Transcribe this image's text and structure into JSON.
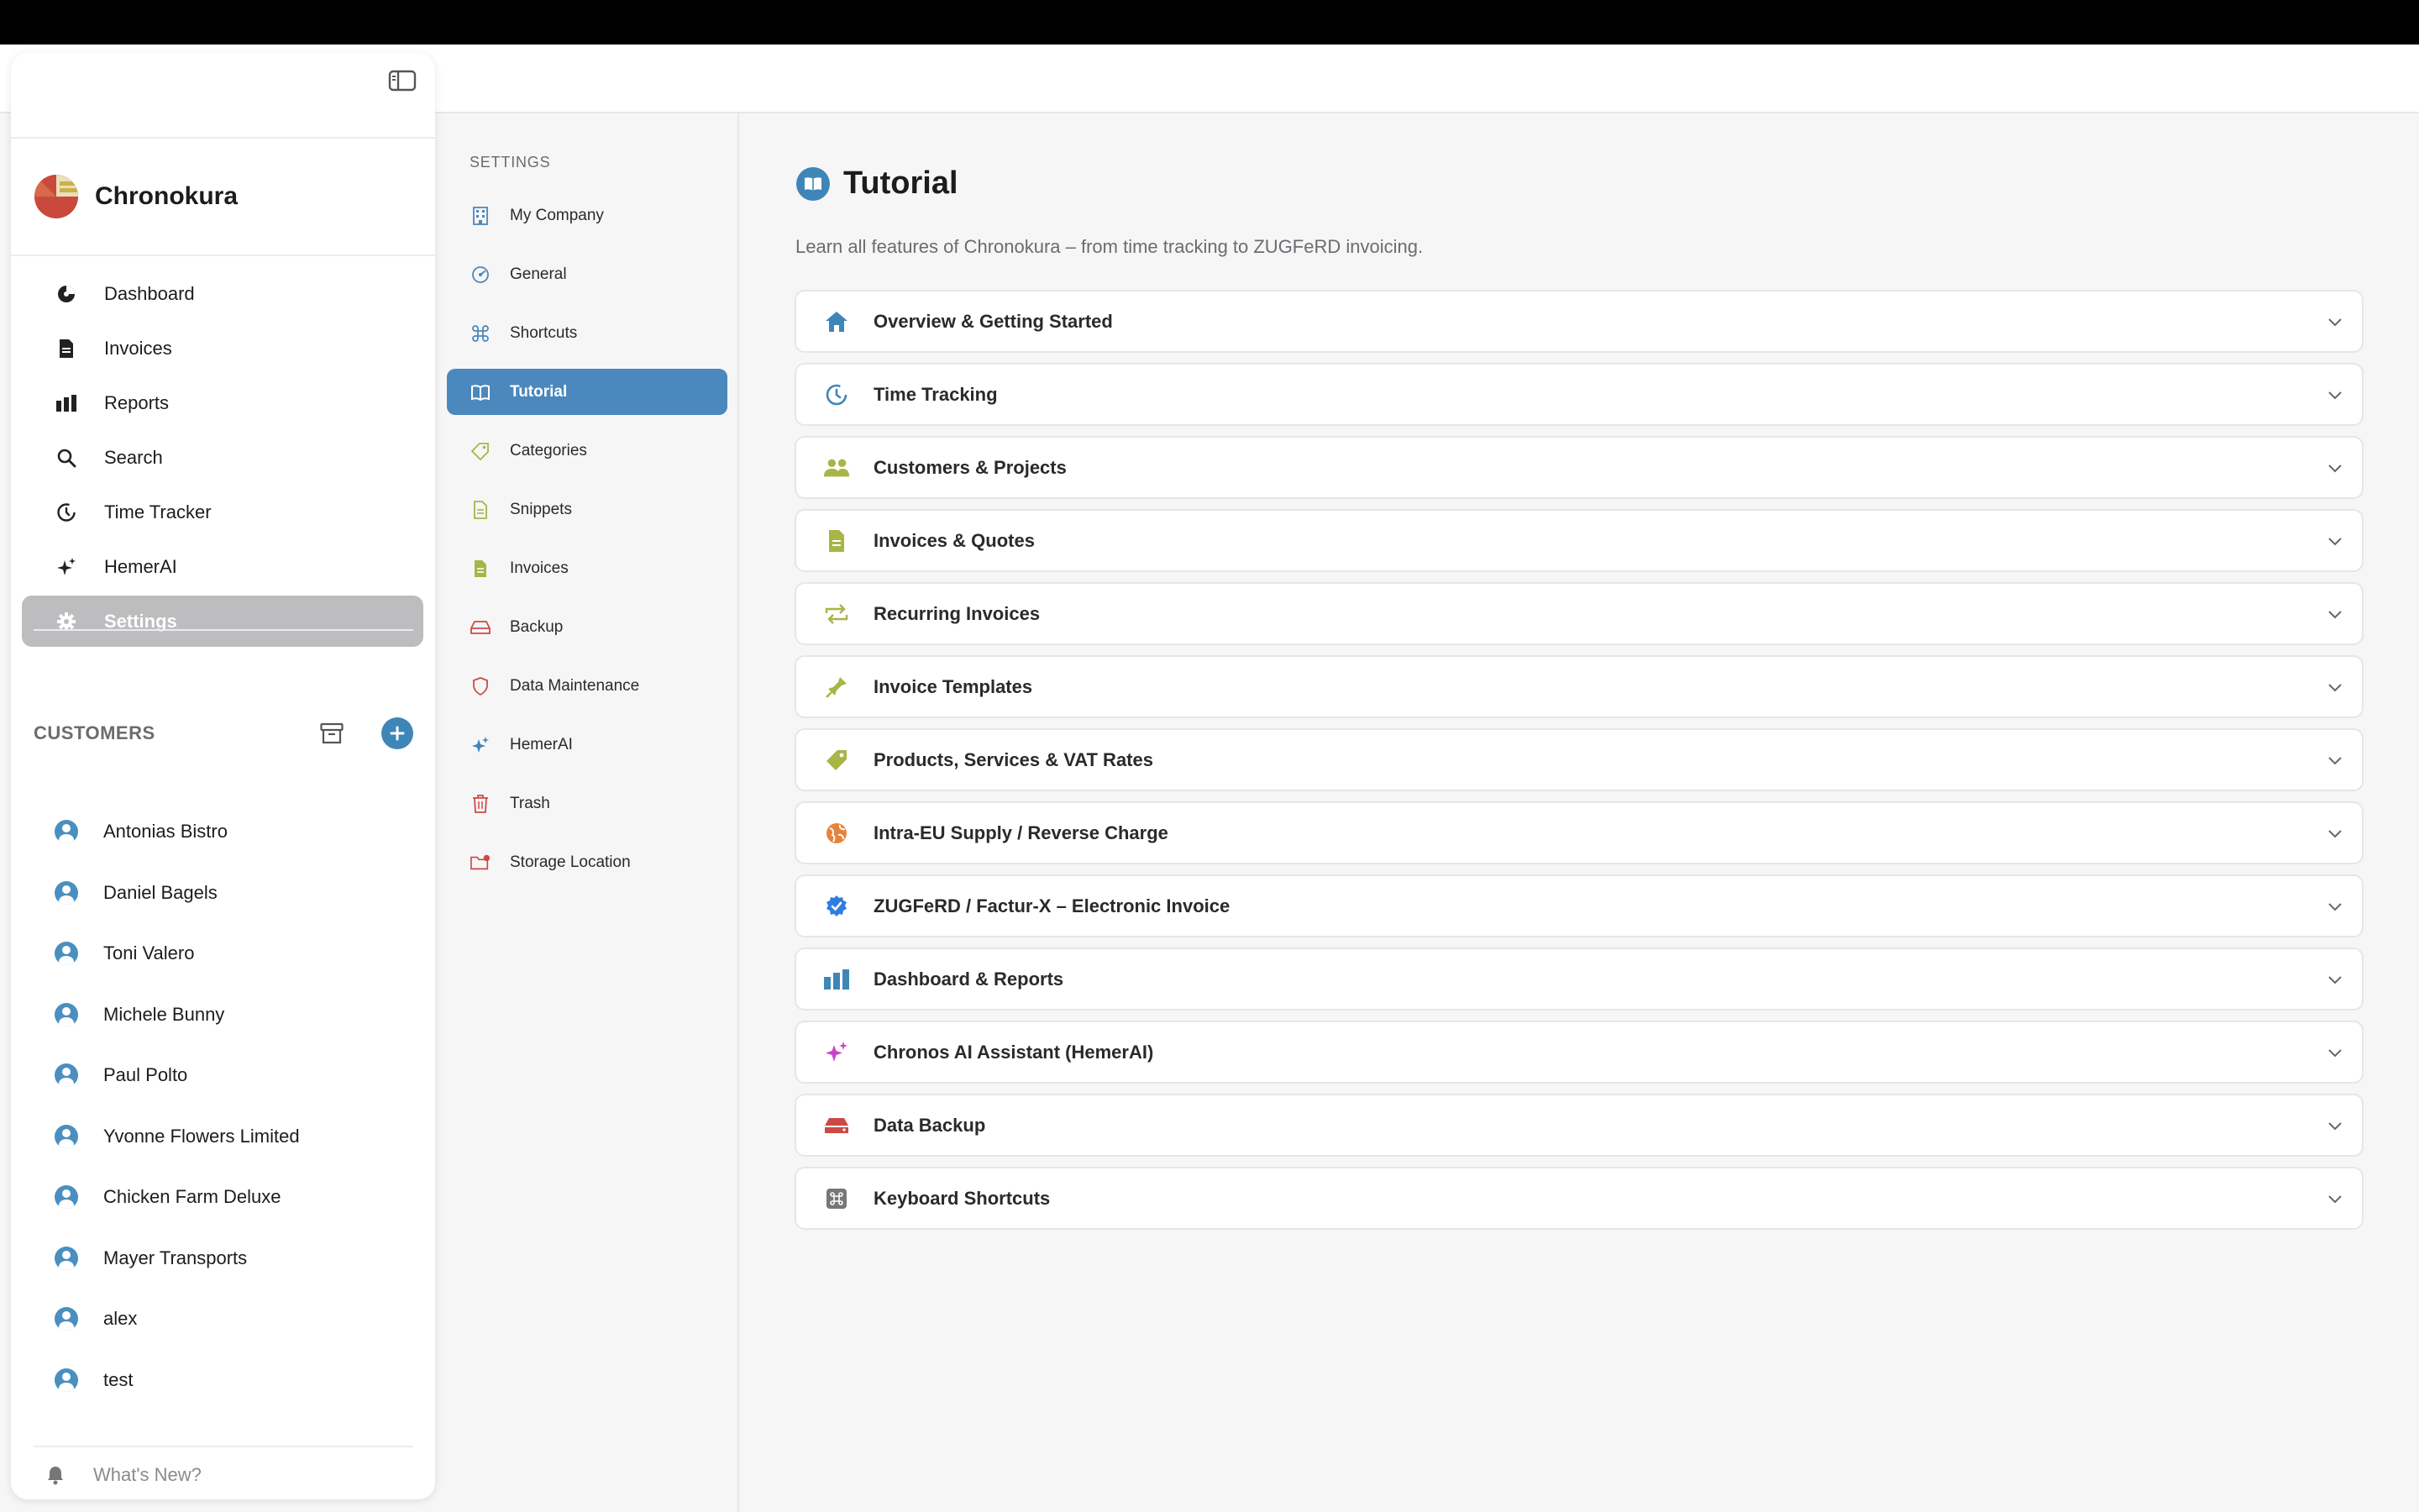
{
  "app": {
    "name": "Chronokura",
    "colors": {
      "accent": "#3f86b8",
      "active_nav": "#bdbdbf",
      "active_setting": "#4a88bd"
    }
  },
  "sidebar": {
    "nav": [
      {
        "label": "Dashboard",
        "icon": "dashboard-icon"
      },
      {
        "label": "Invoices",
        "icon": "document-icon"
      },
      {
        "label": "Reports",
        "icon": "bar-chart-icon"
      },
      {
        "label": "Search",
        "icon": "search-icon"
      },
      {
        "label": "Time Tracker",
        "icon": "timer-icon"
      },
      {
        "label": "HemerAI",
        "icon": "sparkle-icon"
      },
      {
        "label": "Settings",
        "icon": "gear-icon",
        "active": true
      }
    ],
    "customers_title": "CUSTOMERS",
    "customers": [
      "Antonias Bistro",
      "Daniel Bagels",
      "Toni Valero",
      "Michele Bunny",
      "Paul Polto",
      "Yvonne Flowers Limited",
      "Chicken Farm Deluxe",
      "Mayer Transports",
      "alex",
      "test"
    ],
    "whats_new": "What's New?"
  },
  "settings": {
    "label": "SETTINGS",
    "items": [
      {
        "label": "My Company",
        "icon": "building-icon"
      },
      {
        "label": "General",
        "icon": "dial-icon"
      },
      {
        "label": "Shortcuts",
        "icon": "command-icon"
      },
      {
        "label": "Tutorial",
        "icon": "book-icon",
        "active": true
      },
      {
        "label": "Categories",
        "icon": "tag-icon"
      },
      {
        "label": "Snippets",
        "icon": "document-icon"
      },
      {
        "label": "Invoices",
        "icon": "invoice-icon"
      },
      {
        "label": "Backup",
        "icon": "drive-icon"
      },
      {
        "label": "Data Maintenance",
        "icon": "shield-icon"
      },
      {
        "label": "HemerAI",
        "icon": "sparkle-icon"
      },
      {
        "label": "Trash",
        "icon": "trash-icon"
      },
      {
        "label": "Storage Location",
        "icon": "folder-icon"
      }
    ]
  },
  "main": {
    "title": "Tutorial",
    "subtitle": "Learn all features of Chronokura – from time tracking to ZUGFeRD invoicing.",
    "sections": [
      {
        "label": "Overview & Getting Started",
        "icon": "home-icon"
      },
      {
        "label": "Time Tracking",
        "icon": "timer-icon"
      },
      {
        "label": "Customers & Projects",
        "icon": "people-icon"
      },
      {
        "label": "Invoices & Quotes",
        "icon": "document-icon"
      },
      {
        "label": "Recurring Invoices",
        "icon": "repeat-icon"
      },
      {
        "label": "Invoice Templates",
        "icon": "stamp-icon"
      },
      {
        "label": "Products, Services & VAT Rates",
        "icon": "tag-icon"
      },
      {
        "label": "Intra-EU Supply / Reverse Charge",
        "icon": "globe-icon"
      },
      {
        "label": "ZUGFeRD / Factur-X – Electronic Invoice",
        "icon": "verified-badge-icon"
      },
      {
        "label": "Dashboard & Reports",
        "icon": "bar-chart-icon"
      },
      {
        "label": "Chronos AI Assistant (HemerAI)",
        "icon": "sparkle-icon"
      },
      {
        "label": "Data Backup",
        "icon": "drive-icon"
      },
      {
        "label": "Keyboard Shortcuts",
        "icon": "command-icon"
      }
    ]
  }
}
